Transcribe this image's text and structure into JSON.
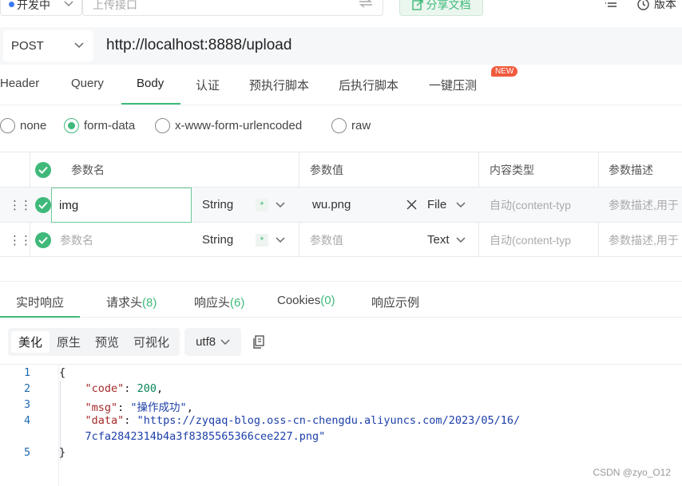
{
  "top": {
    "env_label": "开发中",
    "upload_placeholder": "上传接口",
    "share_label": "分享文档",
    "version_label": "版本"
  },
  "request": {
    "method": "POST",
    "url": "http://localhost:8888/upload"
  },
  "tabs": [
    {
      "label": "Header"
    },
    {
      "label": "Query"
    },
    {
      "label": "Body"
    },
    {
      "label": "认证"
    },
    {
      "label": "预执行脚本"
    },
    {
      "label": "后执行脚本"
    },
    {
      "label": "一键压测"
    }
  ],
  "active_tab": "Body",
  "new_badge": "NEW",
  "body_types": [
    "none",
    "form-data",
    "x-www-form-urlencoded",
    "raw"
  ],
  "selected_body_type": "form-data",
  "params_table": {
    "headers": [
      "参数名",
      "参数值",
      "内容类型",
      "参数描述"
    ],
    "rows": [
      {
        "name": "img",
        "type": "String",
        "required": "*",
        "value": "wu.png",
        "file_type": "File",
        "content_type": "自动(content-typ",
        "description": "参数描述,用于"
      },
      {
        "name_placeholder": "参数名",
        "type": "String",
        "required": "*",
        "value_placeholder": "参数值",
        "file_type": "Text",
        "content_type": "自动(content-typ",
        "description": "参数描述,用于"
      }
    ]
  },
  "response_tabs": [
    {
      "label": "实时响应",
      "count": ""
    },
    {
      "label": "请求头",
      "count": "(8)"
    },
    {
      "label": "响应头",
      "count": "(6)"
    },
    {
      "label": "Cookies",
      "count": "(0)"
    },
    {
      "label": "响应示例",
      "count": ""
    }
  ],
  "view_modes": [
    "美化",
    "原生",
    "预览",
    "可视化"
  ],
  "active_view_mode": "美化",
  "charset": "utf8",
  "response_body": {
    "line_numbers": [
      "1",
      "2",
      "3",
      "4",
      "5"
    ],
    "open_brace": "{",
    "close_brace": "}",
    "code_key": "\"code\"",
    "code_value": "200",
    "msg_key": "\"msg\"",
    "msg_value": "\"操作成功\"",
    "data_key": "\"data\"",
    "data_value_line1": "\"https://zyqaq-blog.oss-cn-chengdu.aliyuncs.com/2023/05/16/",
    "data_value_line2": "7cfa2842314b4a3f8385565366cee227.png\""
  },
  "watermark": "CSDN @zyo_O12",
  "colors": {
    "accent": "#3fb97a",
    "badge": "#f05a3e",
    "env_dot": "#3a7af0"
  }
}
